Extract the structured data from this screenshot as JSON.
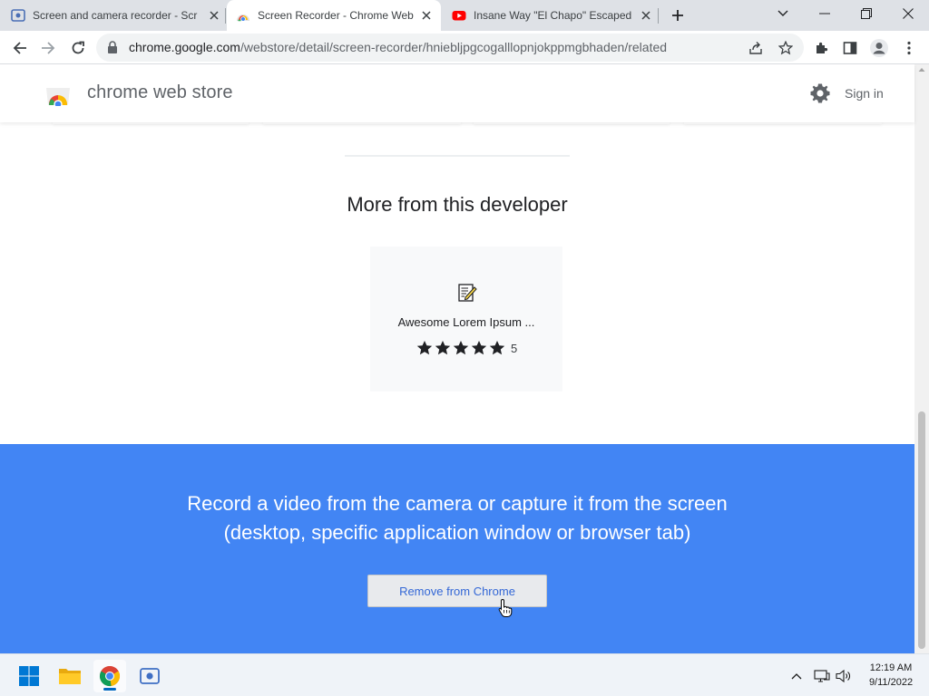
{
  "browser": {
    "tabs": [
      {
        "title": "Screen and camera recorder - Scr",
        "active": false,
        "favicon": "screen-recorder-icon"
      },
      {
        "title": "Screen Recorder - Chrome Web S",
        "active": true,
        "favicon": "chrome-web-store-icon"
      },
      {
        "title": "Insane Way \"El Chapo\" Escaped F",
        "active": false,
        "favicon": "youtube-icon"
      }
    ],
    "url_host": "chrome.google.com",
    "url_path": "/webstore/detail/screen-recorder/hniebljpgcogalllopnjokppmgbhaden/related"
  },
  "store": {
    "title": "chrome web store",
    "signin": "Sign in"
  },
  "more_section": {
    "heading": "More from this developer",
    "card": {
      "name": "Awesome Lorem Ipsum ...",
      "rating": 5,
      "rating_count": "5",
      "icon": "notepad-pencil-icon"
    }
  },
  "banner": {
    "line1": "Record a video from the camera or capture it from the screen",
    "line2": "(desktop, specific application window or browser tab)",
    "button": "Remove from Chrome",
    "color": "#4285f4"
  },
  "taskbar": {
    "apps": [
      "start-icon",
      "file-explorer-icon",
      "chrome-icon",
      "screen-recorder-icon"
    ],
    "time": "12:19 AM",
    "date": "9/11/2022"
  }
}
